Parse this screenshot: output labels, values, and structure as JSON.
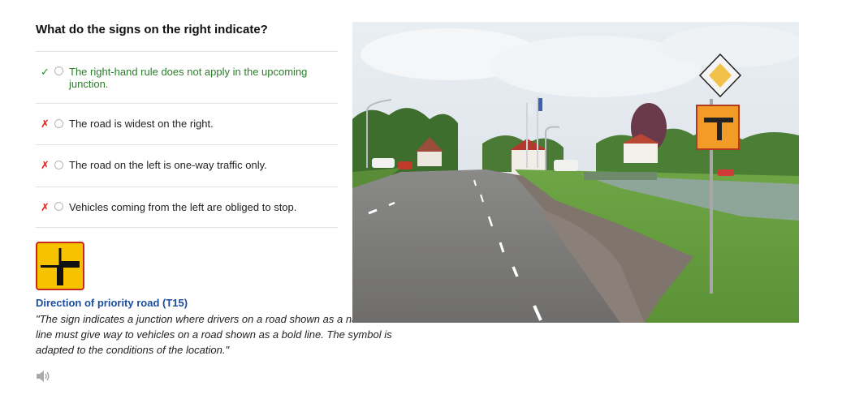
{
  "question": "What do the signs on the right indicate?",
  "options": [
    {
      "text": "The right-hand rule does not apply in the upcoming junction.",
      "mark": "✓",
      "status": "correct"
    },
    {
      "text": "The road is widest on the right.",
      "mark": "✗",
      "status": "incorrect"
    },
    {
      "text": "The road on the left is one-way traffic only.",
      "mark": "✗",
      "status": "incorrect"
    },
    {
      "text": "Vehicles coming from the left are obliged to stop.",
      "mark": "✗",
      "status": "incorrect"
    }
  ],
  "explanation": {
    "sign_title": "Direction of priority road (T15)",
    "sign_text": "\"The sign indicates a junction where drivers on a road shown as a narrow line must give way to vehicles on a road shown as a bold line. The symbol is adapted to the conditions of the location.\"",
    "audio_icon": "speaker-icon"
  },
  "colors": {
    "correct": "#2b7d2b",
    "incorrect": "#d9261c",
    "title_blue": "#1b4d9c",
    "sign_yellow": "#f7c200",
    "sign_border": "#c9281d"
  },
  "photo": {
    "description_icon": "road-scene-photo"
  }
}
